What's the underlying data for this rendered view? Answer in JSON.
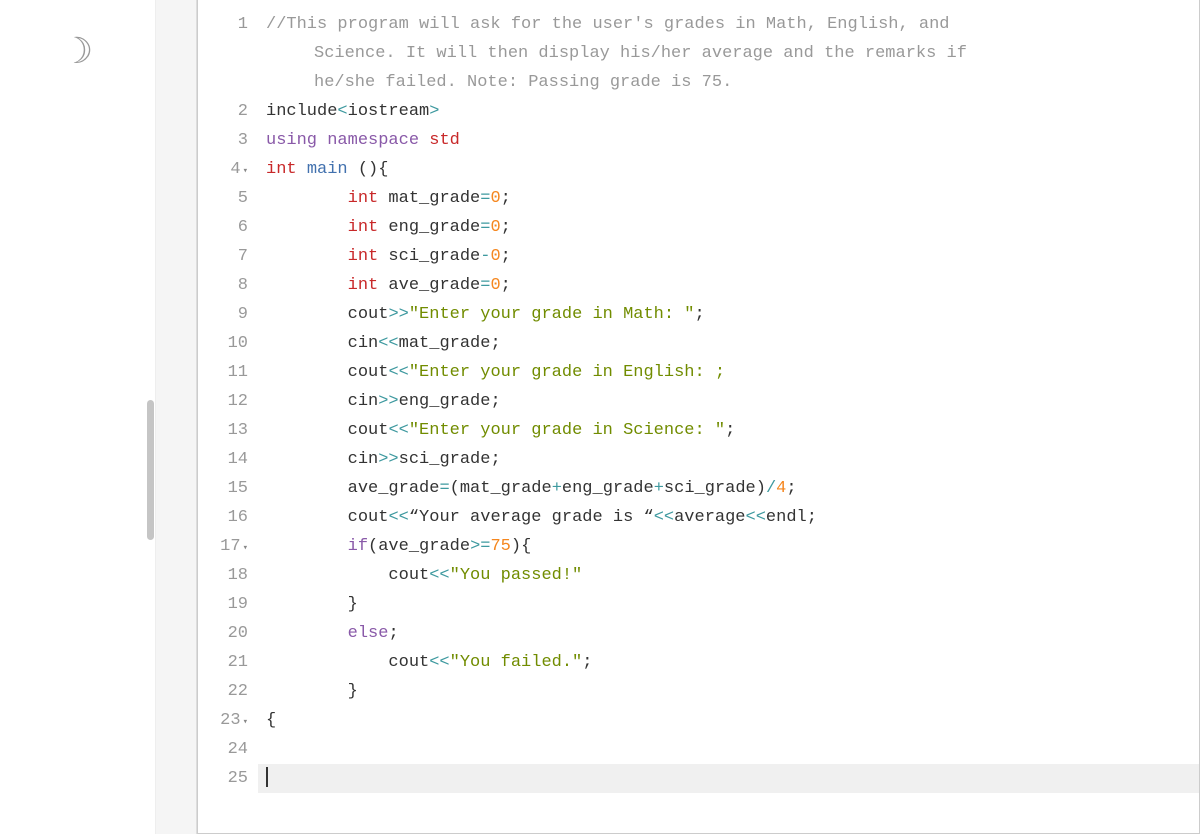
{
  "sidebar": {
    "icon_name": "moon"
  },
  "editor": {
    "lines": [
      {
        "num": "1",
        "fold": "",
        "indent": 0,
        "tokens": [
          {
            "c": "tok-comment",
            "t": "//This program will ask for the user's grades in Math, English, and"
          }
        ]
      },
      {
        "num": "",
        "fold": "",
        "indent": 0,
        "continuation": true,
        "tokens": [
          {
            "c": "tok-comment",
            "t": "Science. It will then display his/her average and the remarks if"
          }
        ]
      },
      {
        "num": "",
        "fold": "",
        "indent": 0,
        "continuation": true,
        "tokens": [
          {
            "c": "tok-comment",
            "t": "he/she failed. Note: Passing grade is 75."
          }
        ]
      },
      {
        "num": "2",
        "fold": "",
        "indent": 0,
        "tokens": [
          {
            "c": "tok-ident",
            "t": "include"
          },
          {
            "c": "tok-operator",
            "t": "<"
          },
          {
            "c": "tok-ident",
            "t": "iostream"
          },
          {
            "c": "tok-operator",
            "t": ">"
          }
        ]
      },
      {
        "num": "3",
        "fold": "",
        "indent": 0,
        "tokens": [
          {
            "c": "tok-keyword",
            "t": "using"
          },
          {
            "c": "tok-ident",
            "t": " "
          },
          {
            "c": "tok-keyword",
            "t": "namespace"
          },
          {
            "c": "tok-ident",
            "t": " "
          },
          {
            "c": "tok-type",
            "t": "std"
          }
        ]
      },
      {
        "num": "4",
        "fold": "▾",
        "indent": 0,
        "tokens": [
          {
            "c": "tok-type",
            "t": "int"
          },
          {
            "c": "tok-ident",
            "t": " "
          },
          {
            "c": "tok-func",
            "t": "main"
          },
          {
            "c": "tok-ident",
            "t": " "
          },
          {
            "c": "tok-punct",
            "t": "(){"
          }
        ]
      },
      {
        "num": "5",
        "fold": "",
        "indent": 2,
        "tokens": [
          {
            "c": "tok-type",
            "t": "int"
          },
          {
            "c": "tok-ident",
            "t": " mat_grade"
          },
          {
            "c": "tok-operator",
            "t": "="
          },
          {
            "c": "tok-number",
            "t": "0"
          },
          {
            "c": "tok-punct",
            "t": ";"
          }
        ]
      },
      {
        "num": "6",
        "fold": "",
        "indent": 2,
        "tokens": [
          {
            "c": "tok-type",
            "t": "int"
          },
          {
            "c": "tok-ident",
            "t": " eng_grade"
          },
          {
            "c": "tok-operator",
            "t": "="
          },
          {
            "c": "tok-number",
            "t": "0"
          },
          {
            "c": "tok-punct",
            "t": ";"
          }
        ]
      },
      {
        "num": "7",
        "fold": "",
        "indent": 2,
        "tokens": [
          {
            "c": "tok-type",
            "t": "int"
          },
          {
            "c": "tok-ident",
            "t": " sci_grade"
          },
          {
            "c": "tok-operator",
            "t": "-"
          },
          {
            "c": "tok-number",
            "t": "0"
          },
          {
            "c": "tok-punct",
            "t": ";"
          }
        ]
      },
      {
        "num": "8",
        "fold": "",
        "indent": 2,
        "tokens": [
          {
            "c": "tok-type",
            "t": "int"
          },
          {
            "c": "tok-ident",
            "t": " ave_grade"
          },
          {
            "c": "tok-operator",
            "t": "="
          },
          {
            "c": "tok-number",
            "t": "0"
          },
          {
            "c": "tok-punct",
            "t": ";"
          }
        ]
      },
      {
        "num": "9",
        "fold": "",
        "indent": 2,
        "tokens": [
          {
            "c": "tok-ident",
            "t": "cout"
          },
          {
            "c": "tok-operator",
            "t": ">>"
          },
          {
            "c": "tok-string",
            "t": "\"Enter your grade in Math: \""
          },
          {
            "c": "tok-punct",
            "t": ";"
          }
        ]
      },
      {
        "num": "10",
        "fold": "",
        "indent": 2,
        "tokens": [
          {
            "c": "tok-ident",
            "t": "cin"
          },
          {
            "c": "tok-operator",
            "t": "<<"
          },
          {
            "c": "tok-ident",
            "t": "mat_grade"
          },
          {
            "c": "tok-punct",
            "t": ";"
          }
        ]
      },
      {
        "num": "11",
        "fold": "",
        "indent": 2,
        "tokens": [
          {
            "c": "tok-ident",
            "t": "cout"
          },
          {
            "c": "tok-operator",
            "t": "<<"
          },
          {
            "c": "tok-string",
            "t": "\"Enter your grade in English: ;"
          }
        ]
      },
      {
        "num": "12",
        "fold": "",
        "indent": 2,
        "tokens": [
          {
            "c": "tok-ident",
            "t": "cin"
          },
          {
            "c": "tok-operator",
            "t": ">>"
          },
          {
            "c": "tok-ident",
            "t": "eng_grade"
          },
          {
            "c": "tok-punct",
            "t": ";"
          }
        ]
      },
      {
        "num": "13",
        "fold": "",
        "indent": 2,
        "tokens": [
          {
            "c": "tok-ident",
            "t": "cout"
          },
          {
            "c": "tok-operator",
            "t": "<<"
          },
          {
            "c": "tok-string",
            "t": "\"Enter your grade in Science: \""
          },
          {
            "c": "tok-punct",
            "t": ";"
          }
        ]
      },
      {
        "num": "14",
        "fold": "",
        "indent": 2,
        "tokens": [
          {
            "c": "tok-ident",
            "t": "cin"
          },
          {
            "c": "tok-operator",
            "t": ">>"
          },
          {
            "c": "tok-ident",
            "t": "sci_grade"
          },
          {
            "c": "tok-punct",
            "t": ";"
          }
        ]
      },
      {
        "num": "15",
        "fold": "",
        "indent": 2,
        "tokens": [
          {
            "c": "tok-ident",
            "t": "ave_grade"
          },
          {
            "c": "tok-operator",
            "t": "="
          },
          {
            "c": "tok-punct",
            "t": "("
          },
          {
            "c": "tok-ident",
            "t": "mat_grade"
          },
          {
            "c": "tok-operator",
            "t": "+"
          },
          {
            "c": "tok-ident",
            "t": "eng_grade"
          },
          {
            "c": "tok-operator",
            "t": "+"
          },
          {
            "c": "tok-ident",
            "t": "sci_grade"
          },
          {
            "c": "tok-punct",
            "t": ")"
          },
          {
            "c": "tok-operator",
            "t": "/"
          },
          {
            "c": "tok-number",
            "t": "4"
          },
          {
            "c": "tok-punct",
            "t": ";"
          }
        ]
      },
      {
        "num": "16",
        "fold": "",
        "indent": 2,
        "tokens": [
          {
            "c": "tok-ident",
            "t": "cout"
          },
          {
            "c": "tok-operator",
            "t": "<<"
          },
          {
            "c": "tok-ident",
            "t": "“Your average grade is “"
          },
          {
            "c": "tok-operator",
            "t": "<<"
          },
          {
            "c": "tok-ident",
            "t": "average"
          },
          {
            "c": "tok-operator",
            "t": "<<"
          },
          {
            "c": "tok-ident",
            "t": "endl"
          },
          {
            "c": "tok-punct",
            "t": ";"
          }
        ]
      },
      {
        "num": "17",
        "fold": "▾",
        "indent": 2,
        "tokens": [
          {
            "c": "tok-keyword",
            "t": "if"
          },
          {
            "c": "tok-punct",
            "t": "("
          },
          {
            "c": "tok-ident",
            "t": "ave_grade"
          },
          {
            "c": "tok-operator",
            "t": ">="
          },
          {
            "c": "tok-number",
            "t": "75"
          },
          {
            "c": "tok-punct",
            "t": "){"
          }
        ]
      },
      {
        "num": "18",
        "fold": "",
        "indent": 3,
        "tokens": [
          {
            "c": "tok-ident",
            "t": "cout"
          },
          {
            "c": "tok-operator",
            "t": "<<"
          },
          {
            "c": "tok-string",
            "t": "\"You passed!\""
          }
        ]
      },
      {
        "num": "19",
        "fold": "",
        "indent": 2,
        "tokens": [
          {
            "c": "tok-punct",
            "t": "}"
          }
        ]
      },
      {
        "num": "20",
        "fold": "",
        "indent": 2,
        "tokens": [
          {
            "c": "tok-keyword",
            "t": "else"
          },
          {
            "c": "tok-punct",
            "t": ";"
          }
        ]
      },
      {
        "num": "21",
        "fold": "",
        "indent": 3,
        "tokens": [
          {
            "c": "tok-ident",
            "t": "cout"
          },
          {
            "c": "tok-operator",
            "t": "<<"
          },
          {
            "c": "tok-string",
            "t": "\"You failed.\""
          },
          {
            "c": "tok-punct",
            "t": ";"
          }
        ]
      },
      {
        "num": "22",
        "fold": "",
        "indent": 2,
        "tokens": [
          {
            "c": "tok-punct",
            "t": "}"
          }
        ]
      },
      {
        "num": "23",
        "fold": "▾",
        "indent": 0,
        "tokens": [
          {
            "c": "tok-punct",
            "t": "{"
          }
        ]
      },
      {
        "num": "24",
        "fold": "",
        "indent": 0,
        "tokens": []
      },
      {
        "num": "25",
        "fold": "",
        "indent": 0,
        "active": true,
        "cursor": true,
        "tokens": []
      }
    ]
  }
}
